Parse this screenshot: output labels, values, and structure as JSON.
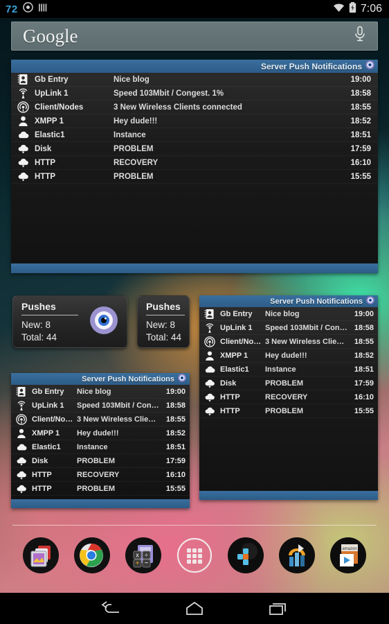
{
  "status_bar": {
    "badge_count": "72",
    "left_icons": [
      "eye-icon",
      "bars-icon"
    ],
    "right_icons": [
      "wifi-icon",
      "battery-charging-icon"
    ],
    "time": "7:06"
  },
  "search_widget": {
    "logo_text": "Google",
    "placeholder": "Google",
    "mic_icon": "microphone-icon"
  },
  "notification_widget": {
    "title": "Server Push Notifications",
    "header_icon": "eye-icon",
    "rows": [
      {
        "icon": "contact-card-icon",
        "source": "Gb Entry",
        "source_short": "Gb Entry",
        "message": "Nice blog",
        "message_short": "Nice blog",
        "time": "19:00"
      },
      {
        "icon": "uplink-antenna-icon",
        "source": "UpLink 1",
        "source_short": "UpLink 1",
        "message": "Speed 103Mbit / Congest. 1%",
        "message_short": "Speed 103Mbit / Cong…",
        "time": "18:58"
      },
      {
        "icon": "wireless-radar-icon",
        "source": "Client/Nodes",
        "source_short": "Client/No…",
        "message": "3 New Wireless Clients connected",
        "message_short": "3 New Wireless Clients…",
        "time": "18:55"
      },
      {
        "icon": "person-icon",
        "source": "XMPP 1",
        "source_short": "XMPP 1",
        "message": "Hey dude!!!",
        "message_short": "Hey dude!!!",
        "time": "18:52"
      },
      {
        "icon": "cloud-icon",
        "source": "Elastic1",
        "source_short": "Elastic1",
        "message": "Instance",
        "message_short": "Instance",
        "time": "18:51"
      },
      {
        "icon": "cloud-download-icon",
        "source": "Disk",
        "source_short": "Disk",
        "message": "PROBLEM",
        "message_short": "PROBLEM",
        "time": "17:59"
      },
      {
        "icon": "cloud-download-icon",
        "source": "HTTP",
        "source_short": "HTTP",
        "message": "RECOVERY",
        "message_short": "RECOVERY",
        "time": "16:10"
      },
      {
        "icon": "cloud-download-icon",
        "source": "HTTP",
        "source_short": "HTTP",
        "message": "PROBLEM",
        "message_short": "PROBLEM",
        "time": "15:55"
      }
    ]
  },
  "pushes_widget_large": {
    "title": "Pushes",
    "new_label": "New: 8",
    "total_label": "Total: 44",
    "icon": "eye-icon"
  },
  "pushes_widget_small": {
    "title": "Pushes",
    "new_label": "New: 8",
    "total_label": "Total: 44"
  },
  "dock": {
    "items": [
      {
        "name": "gallery",
        "icon": "gallery-icon"
      },
      {
        "name": "chrome",
        "icon": "chrome-icon"
      },
      {
        "name": "calculator",
        "icon": "calculator-icon"
      },
      {
        "name": "app-drawer",
        "icon": "apps-grid-icon"
      },
      {
        "name": "plus-app",
        "icon": "plus-shortcut-icon"
      },
      {
        "name": "tools-app",
        "icon": "tools-icon"
      },
      {
        "name": "store-folder",
        "icon": "play-store-icon"
      }
    ]
  },
  "nav_bar": {
    "back": "back-icon",
    "home": "home-icon",
    "recents": "recents-icon"
  },
  "colors": {
    "accent_blue": "#3a6f9e",
    "status_badge": "#3da4d8",
    "widget_bg": "#1a1a1a",
    "eye_purple": "#9b93d0"
  }
}
